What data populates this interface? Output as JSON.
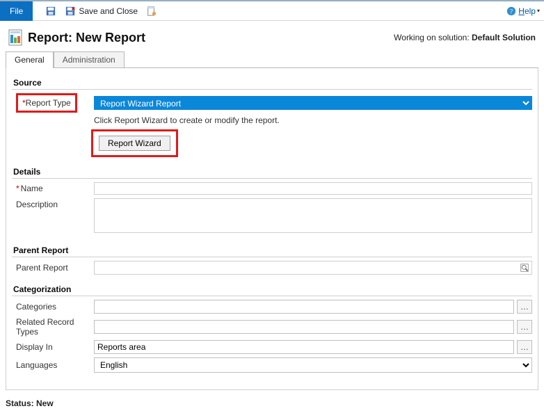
{
  "toolbar": {
    "file_label": "File",
    "save_close_label": "Save and Close",
    "help_label": "Help"
  },
  "header": {
    "title": "Report: New Report",
    "solution_prefix": "Working on solution: ",
    "solution_name": "Default Solution"
  },
  "tabs": {
    "general": "General",
    "administration": "Administration"
  },
  "sections": {
    "source": "Source",
    "details": "Details",
    "parent_report": "Parent Report",
    "categorization": "Categorization"
  },
  "fields": {
    "report_type": {
      "label": "Report Type",
      "value": "Report Wizard Report",
      "hint": "Click Report Wizard to create or modify the report.",
      "button": "Report Wizard"
    },
    "name": {
      "label": "Name",
      "value": ""
    },
    "description": {
      "label": "Description",
      "value": ""
    },
    "parent_report": {
      "label": "Parent Report",
      "value": ""
    },
    "categories": {
      "label": "Categories",
      "value": ""
    },
    "related_record_types": {
      "label": "Related Record Types",
      "value": ""
    },
    "display_in": {
      "label": "Display In",
      "value": "Reports area"
    },
    "languages": {
      "label": "Languages",
      "value": "English"
    }
  },
  "status": {
    "label": "Status:",
    "value": "New"
  }
}
